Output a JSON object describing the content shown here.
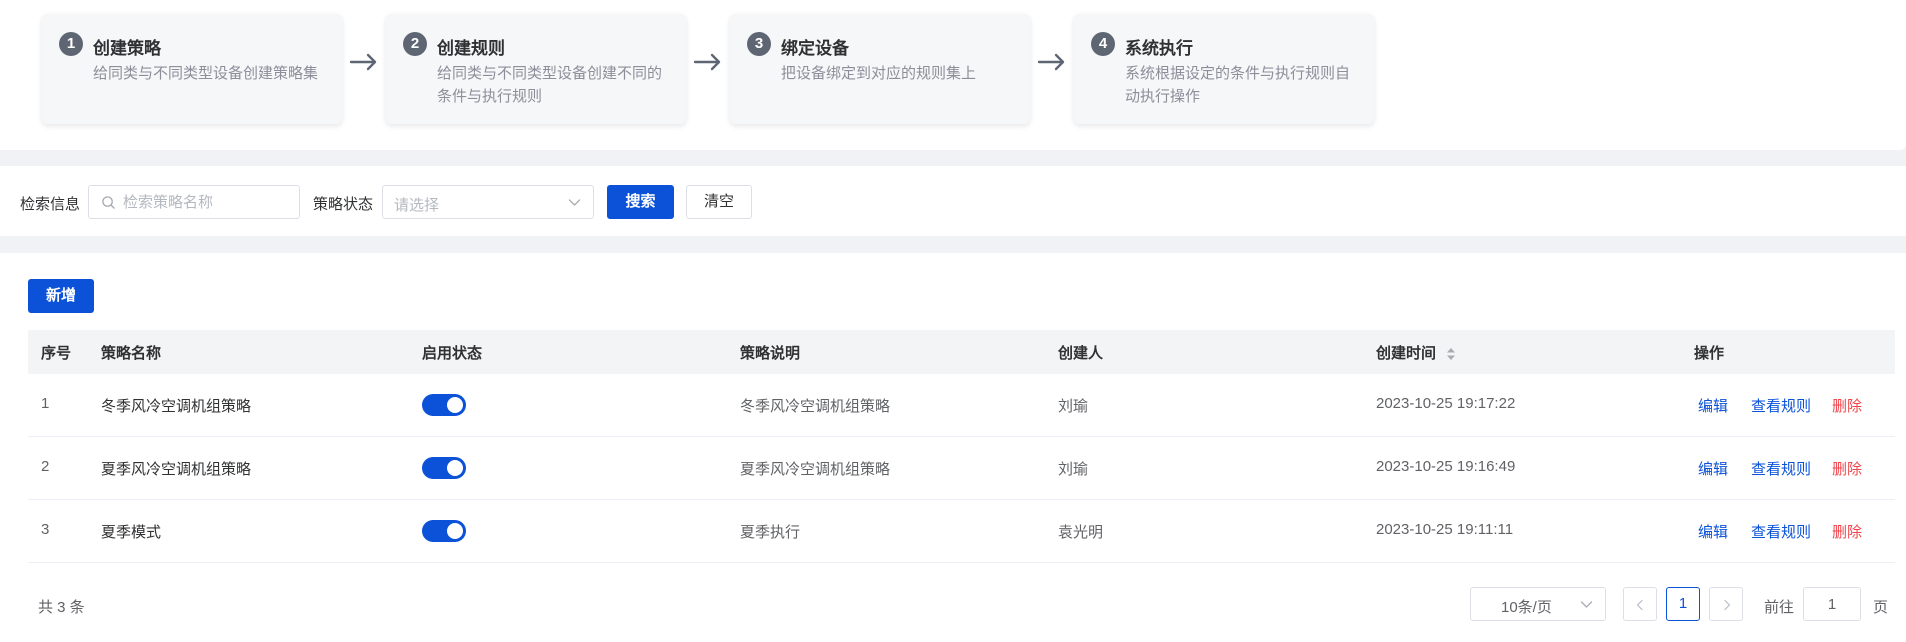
{
  "steps": [
    {
      "num": "1",
      "title": "创建策略",
      "desc": "给同类与不同类型设备创建策略集"
    },
    {
      "num": "2",
      "title": "创建规则",
      "desc": "给同类与不同类型设备创建不同的条件与执行规则"
    },
    {
      "num": "3",
      "title": "绑定设备",
      "desc": "把设备绑定到对应的规则集上"
    },
    {
      "num": "4",
      "title": "系统执行",
      "desc": "系统根据设定的条件与执行规则自动执行操作"
    }
  ],
  "search": {
    "info_label": "检索信息",
    "name_placeholder": "检索策略名称",
    "status_label": "策略状态",
    "status_placeholder": "请选择",
    "search_button": "搜索",
    "clear_button": "清空"
  },
  "toolbar": {
    "add_button": "新增"
  },
  "table": {
    "columns": {
      "index": "序号",
      "name": "策略名称",
      "status": "启用状态",
      "desc": "策略说明",
      "creator": "创建人",
      "created": "创建时间",
      "actions": "操作"
    },
    "rows": [
      {
        "index": "1",
        "name": "冬季风冷空调机组策略",
        "enabled": true,
        "desc": "冬季风冷空调机组策略",
        "creator": "刘瑜",
        "created": "2023-10-25 19:17:22"
      },
      {
        "index": "2",
        "name": "夏季风冷空调机组策略",
        "enabled": true,
        "desc": "夏季风冷空调机组策略",
        "creator": "刘瑜",
        "created": "2023-10-25 19:16:49"
      },
      {
        "index": "3",
        "name": "夏季模式",
        "enabled": true,
        "desc": "夏季执行",
        "creator": "袁光明",
        "created": "2023-10-25 19:11:11"
      }
    ],
    "actions": {
      "edit": "编辑",
      "view_rules": "查看规则",
      "delete": "删除"
    }
  },
  "pagination": {
    "total": "共 3 条",
    "page_size": "10条/页",
    "current_page": "1",
    "goto_label": "前往",
    "goto_value": "1",
    "page_unit": "页"
  },
  "colors": {
    "primary": "#0b52d9",
    "danger": "#f0454c"
  }
}
